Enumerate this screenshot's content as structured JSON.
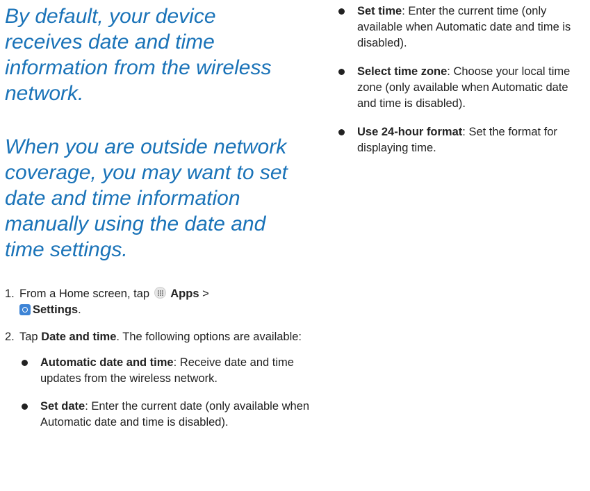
{
  "intro": {
    "paragraph_1": "By default, your device receives date and time information from the wireless network.",
    "paragraph_2": "When you are outside network coverage, you may want to set date and time information manually using the date and time settings."
  },
  "steps": [
    {
      "number": "1.",
      "before": "From a Home screen, tap",
      "apps_label": "Apps",
      "separator": ">",
      "settings_label": "Settings",
      "after": "."
    },
    {
      "number": "2.",
      "before": "Tap",
      "target_label": "Date and time",
      "after": ". The following options are available:"
    }
  ],
  "options": [
    {
      "title": "Automatic date and time",
      "desc": ": Receive date and time updates from the wireless network."
    },
    {
      "title": "Set date",
      "desc": ": Enter the current date (only available when Automatic date and time is disabled)."
    },
    {
      "title": "Set time",
      "desc": ": Enter the current time (only available when Automatic date and time is disabled)."
    },
    {
      "title": "Select time zone",
      "desc": ": Choose your local time zone (only available when Automatic date and time is disabled)."
    },
    {
      "title": "Use 24-hour format",
      "desc": ": Set the format for displaying time."
    }
  ],
  "icons": {
    "apps": "apps-icon",
    "settings": "settings-icon"
  },
  "colors": {
    "intro_text": "#1a73b8",
    "body_text": "#222222",
    "settings_icon": "#3d84d6"
  }
}
